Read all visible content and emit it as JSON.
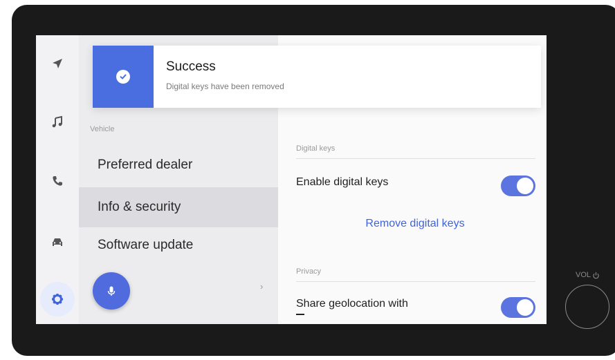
{
  "rail": {
    "items": [
      {
        "name": "navigation",
        "icon": "navigation-arrow-icon"
      },
      {
        "name": "media",
        "icon": "music-note-icon"
      },
      {
        "name": "phone",
        "icon": "phone-icon"
      },
      {
        "name": "vehicle",
        "icon": "car-icon"
      },
      {
        "name": "settings",
        "icon": "gear-icon",
        "active": true
      }
    ]
  },
  "settings_list": {
    "section_label": "Vehicle",
    "items": [
      {
        "label": "Preferred dealer"
      },
      {
        "label": "Info & security",
        "selected": true
      },
      {
        "label": "Software update"
      }
    ],
    "chevron": "›"
  },
  "detail": {
    "digital_keys": {
      "section_label": "Digital keys",
      "enable_label": "Enable digital keys",
      "enable_on": true,
      "remove_link": "Remove digital keys"
    },
    "privacy": {
      "section_label": "Privacy",
      "share_label": "Share geolocation with",
      "share_on": true
    }
  },
  "notification": {
    "title": "Success",
    "message": "Digital keys have been removed",
    "icon": "check-circle-icon"
  },
  "hardware": {
    "volume_label": "VOL"
  },
  "colors": {
    "accent": "#4a6ee0",
    "toggle_on": "#5b74e0",
    "link": "#3f63dc"
  }
}
